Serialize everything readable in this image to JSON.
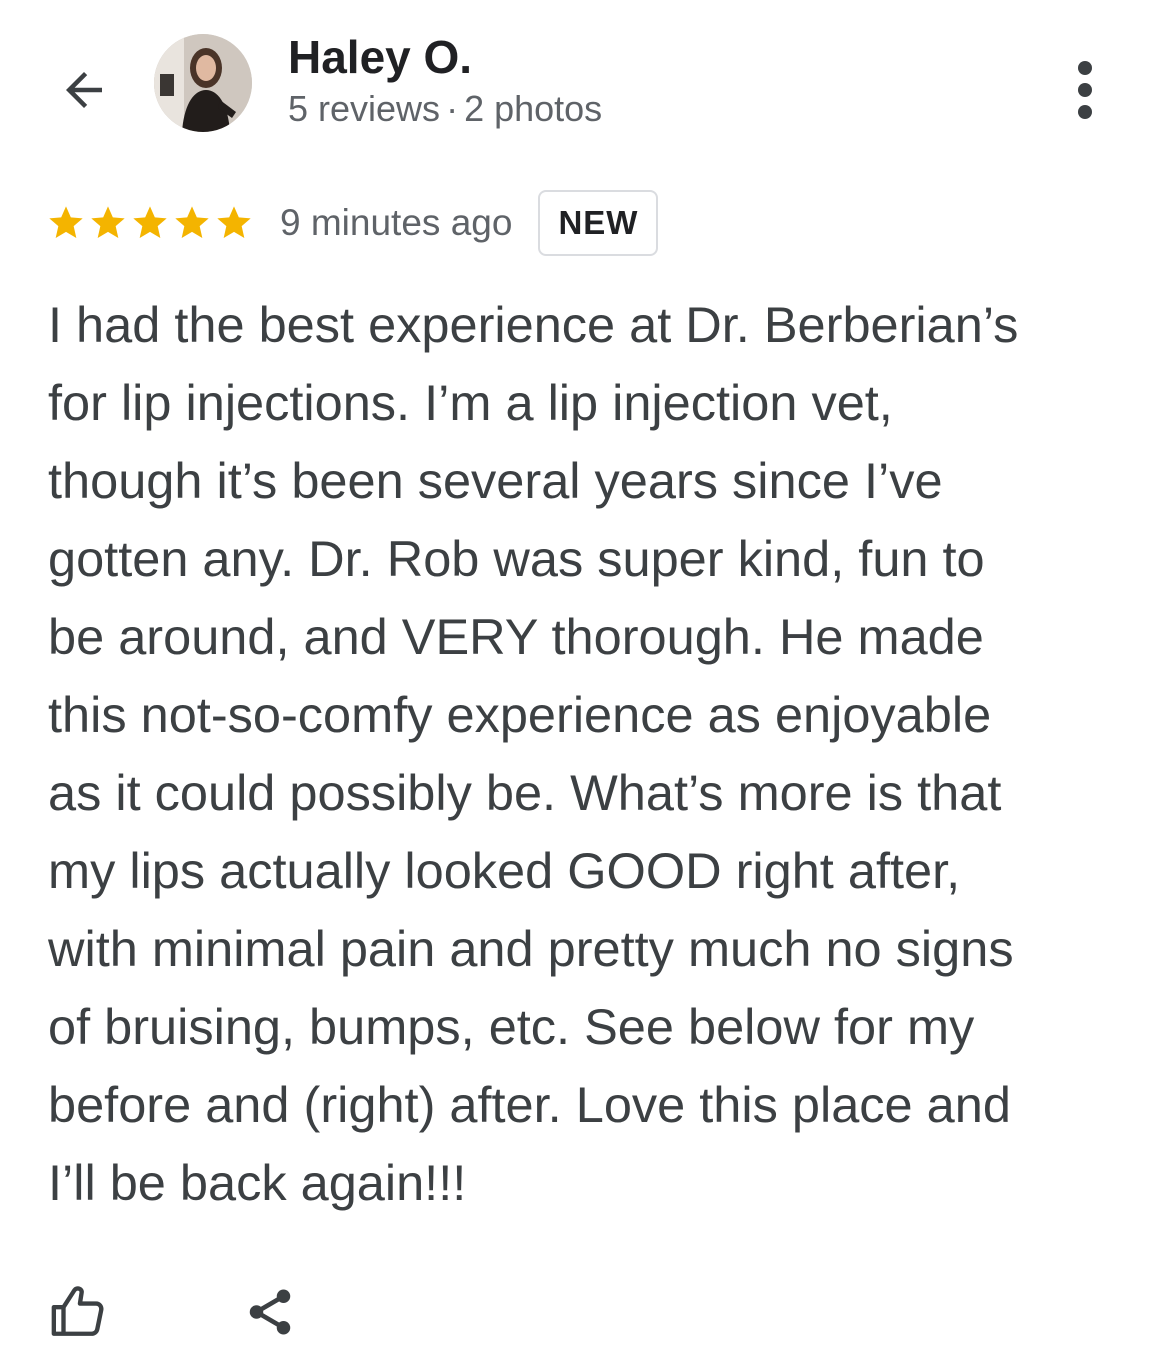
{
  "header": {
    "back_icon": "arrow-back-icon",
    "reviewer_name": "Haley O.",
    "reviews_count": "5 reviews",
    "separator": "·",
    "photos_count": "2 photos",
    "more_icon": "more-vert-icon"
  },
  "review": {
    "rating": 5,
    "rating_max": 5,
    "star_color": "#f4b400",
    "time_ago": "9 minutes ago",
    "badge": "NEW",
    "lines": [
      "I had the best experience at Dr. Berberian’s",
      "for lip injections. I’m a lip injection vet,",
      "though it’s been several years since I’ve",
      "gotten any. Dr. Rob was super kind, fun to",
      "be around, and VERY thorough. He made",
      "this not-so-comfy experience as enjoyable",
      "as it could possibly be. What’s more is that",
      "my lips actually looked GOOD right after,",
      "with minimal pain and pretty much no signs",
      "of bruising, bumps, etc. See below for my",
      "before and (right) after. Love this place and",
      "I’ll be back again!!!"
    ]
  },
  "actions": {
    "like_icon": "thumb-up-icon",
    "share_icon": "share-icon"
  }
}
